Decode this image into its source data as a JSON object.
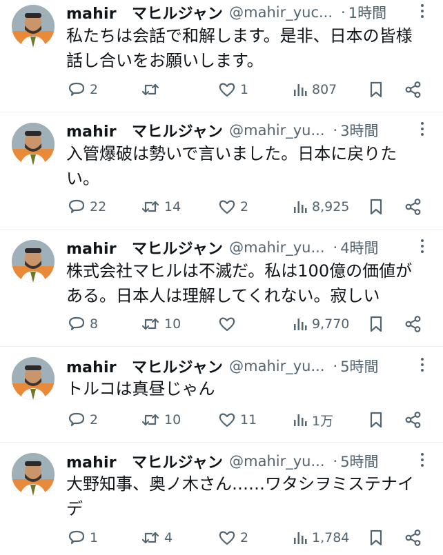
{
  "colors": {
    "text": "#0f1419",
    "secondary": "#536471",
    "divider": "#eff3f4"
  },
  "icons": [
    "reply-icon",
    "retweet-icon",
    "like-icon",
    "views-icon",
    "bookmark-icon",
    "share-icon",
    "more-icon"
  ],
  "tweets": [
    {
      "name": "mahir　マヒルジャン",
      "handle": "@mahir_yuc...",
      "separator": "·",
      "time": "1時間",
      "text": "私たちは会話で和解します。是非、日本の皆様\n話し合いをお願いします。",
      "replies": "2",
      "retweets": "",
      "likes": "1",
      "views": "807"
    },
    {
      "name": "mahir　マヒルジャン",
      "handle": "@mahir_yu...",
      "separator": "·",
      "time": "3時間",
      "text": "入管爆破は勢いで言いました。日本に戻りた\nい。",
      "replies": "22",
      "retweets": "14",
      "likes": "2",
      "views": "8,925"
    },
    {
      "name": "mahir　マヒルジャン",
      "handle": "@mahir_yu...",
      "separator": "·",
      "time": "4時間",
      "text": "株式会社マヒルは不滅だ。私は100億の価値が\nある。日本人は理解してくれない。寂しい",
      "replies": "8",
      "retweets": "10",
      "likes": "",
      "views": "9,770"
    },
    {
      "name": "mahir　マヒルジャン",
      "handle": "@mahir_yu...",
      "separator": "·",
      "time": "5時間",
      "text": "トルコは真昼じゃん",
      "replies": "2",
      "retweets": "10",
      "likes": "11",
      "views": "1万"
    },
    {
      "name": "mahir　マヒルジャン",
      "handle": "@mahir_yu...",
      "separator": "·",
      "time": "5時間",
      "text": "大野知事、奥ノ木さん……ワタシヲミステナイ\nデ",
      "replies": "1",
      "retweets": "4",
      "likes": "2",
      "views": "1,784"
    }
  ]
}
